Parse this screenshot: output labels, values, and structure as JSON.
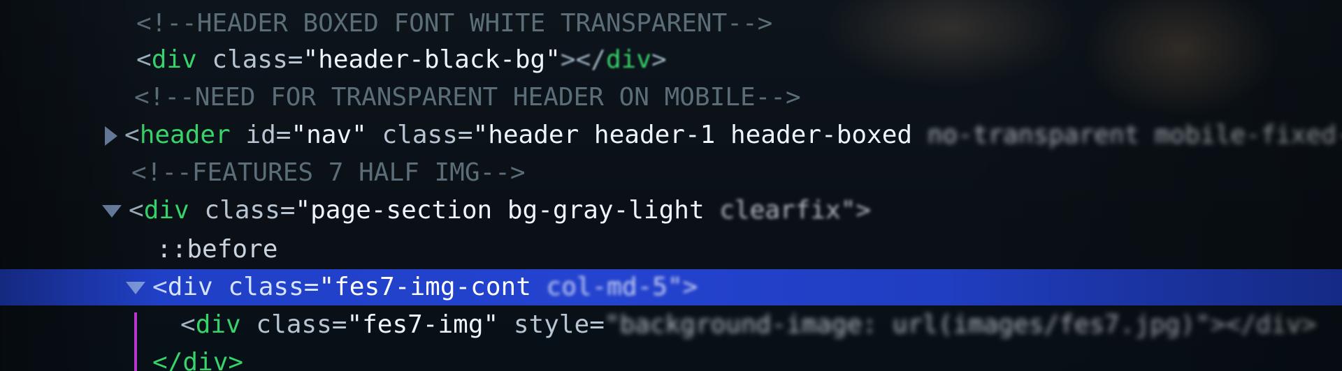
{
  "editor": {
    "lines": [
      {
        "id": "comment-header-boxed",
        "text": "<!--HEADER BOXED FONT WHITE TRANSPARENT-->"
      },
      {
        "id": "div-header-black-bg",
        "open": "<",
        "tag": "div",
        "attr": " class=",
        "value": "\"header-black-bg\"",
        "close_open": "></",
        "close_tag": "div",
        "close": ">"
      },
      {
        "id": "comment-need-transparent",
        "text": "<!--NEED FOR TRANSPARENT HEADER ON MOBILE-->"
      },
      {
        "id": "header-nav",
        "open": "<",
        "tag": "header",
        "attr1": " id=",
        "value1": "\"nav\"",
        "attr2": " class=",
        "value2": "\"header header-1 header-boxed ",
        "value2_blur": "no-transparent mobile-fixed-header black-header"
      },
      {
        "id": "comment-features",
        "text": "<!--FEATURES 7 HALF IMG-->"
      },
      {
        "id": "div-page-section",
        "open": "<",
        "tag": "div",
        "attr": " class=",
        "value": "\"page-section bg-gray-light ",
        "value_blur": "clearfix\">"
      },
      {
        "id": "pseudo-before",
        "text": "::before"
      },
      {
        "id": "div-fes7-img-cont",
        "open": "<",
        "tag": "div",
        "attr": " class=",
        "value": "\"fes7-img-cont ",
        "value_blur": "col-md-5\">"
      },
      {
        "id": "div-fes7-img",
        "open": "<",
        "tag": "div",
        "attr": " class=",
        "value": "\"fes7-img\"",
        "attr2": " style=",
        "value2_blur": "\"background-image: url(images/fes7.jpg)\"></div>"
      },
      {
        "id": "close-div",
        "text": "</div>"
      }
    ]
  },
  "colors": {
    "selection": "#2443cf",
    "tag": "#37d36b",
    "comment": "#5b6e78",
    "guide": "#c43ad6"
  },
  "icons": [
    "expand-arrow-icon",
    "collapse-arrow-icon"
  ]
}
